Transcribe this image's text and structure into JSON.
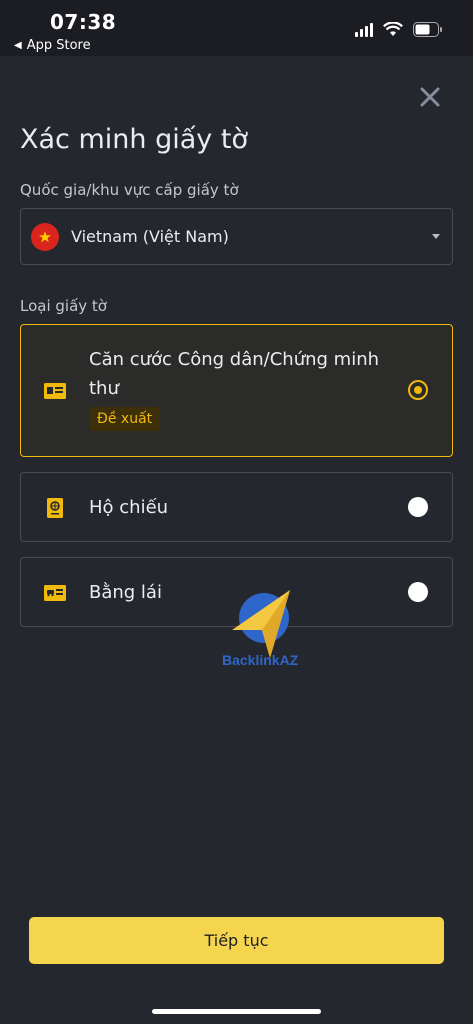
{
  "status_bar": {
    "time": "07:38",
    "back_app": "App Store"
  },
  "sheet": {
    "title": "Xác minh giấy tờ",
    "country_label": "Quốc gia/khu vực cấp giấy tờ",
    "country_value": "Vietnam (Việt Nam)",
    "doc_type_label": "Loại giấy tờ",
    "options": [
      {
        "label": "Căn cước Công dân/Chứng minh thư",
        "badge": "Đề xuất",
        "selected": true,
        "icon": "id-card-icon"
      },
      {
        "label": "Hộ chiếu",
        "selected": false,
        "icon": "passport-icon"
      },
      {
        "label": "Bằng lái",
        "selected": false,
        "icon": "driver-license-icon"
      }
    ],
    "continue_label": "Tiếp tục"
  },
  "watermark": {
    "text": "BacklinkAZ"
  },
  "colors": {
    "accent": "#f0b90b",
    "button": "#f5d54d",
    "background": "#24272d",
    "text": "#eaecef"
  }
}
